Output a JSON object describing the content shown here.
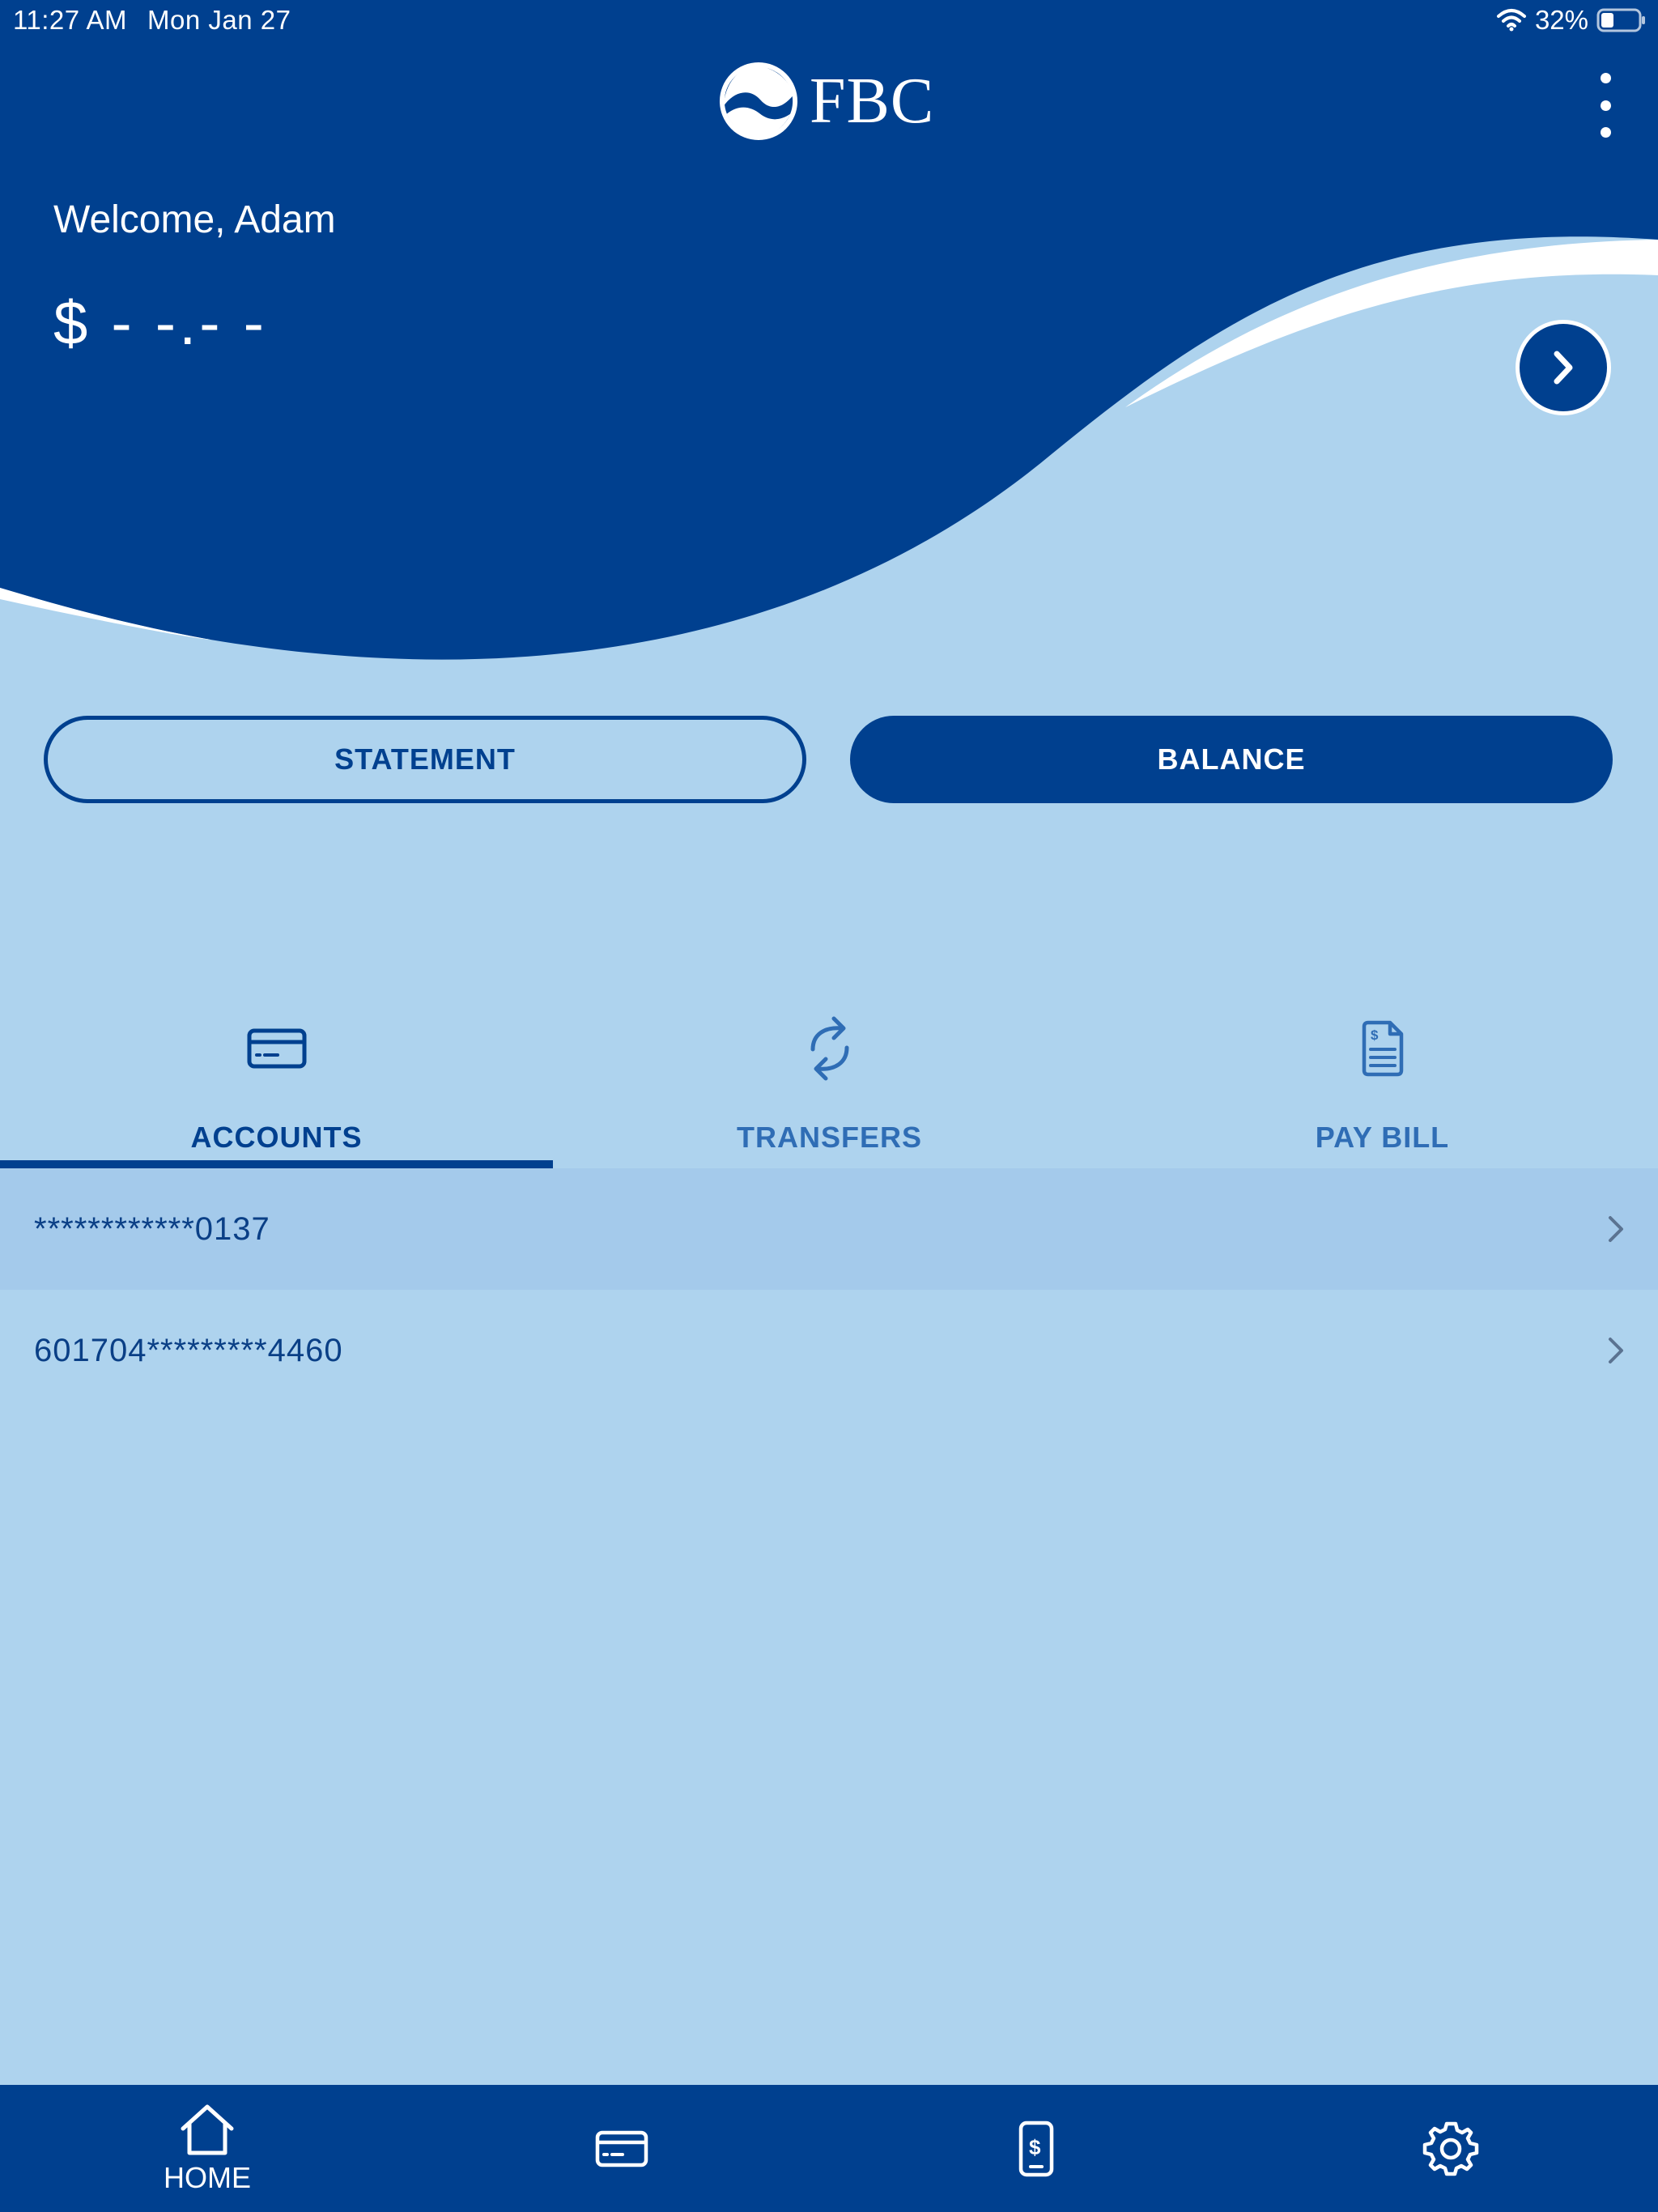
{
  "status_bar": {
    "time": "11:27 AM",
    "date": "Mon Jan 27",
    "battery": "32%"
  },
  "header": {
    "brand": "FBC"
  },
  "hero": {
    "welcome": "Welcome, Adam",
    "balance": "$ - -.- -"
  },
  "actions": {
    "statement_label": "STATEMENT",
    "balance_label": "BALANCE"
  },
  "tabs": [
    {
      "label": "ACCOUNTS",
      "icon": "card-icon",
      "selected": true
    },
    {
      "label": "TRANSFERS",
      "icon": "transfer-icon",
      "selected": false
    },
    {
      "label": "PAY BILL",
      "icon": "bill-icon",
      "selected": false
    }
  ],
  "accounts": [
    {
      "number": "************0137"
    },
    {
      "number": "601704*********4460"
    }
  ],
  "bottom_nav": {
    "items": [
      {
        "label": "HOME",
        "icon": "home-icon"
      },
      {
        "label": "",
        "icon": "card-icon"
      },
      {
        "label": "",
        "icon": "mobile-pay-icon"
      },
      {
        "label": "",
        "icon": "gear-icon"
      }
    ]
  },
  "colors": {
    "primary": "#00408f",
    "background": "#aed3ee",
    "selected_row": "#a4caeb",
    "text_on_primary": "#ffffff"
  }
}
